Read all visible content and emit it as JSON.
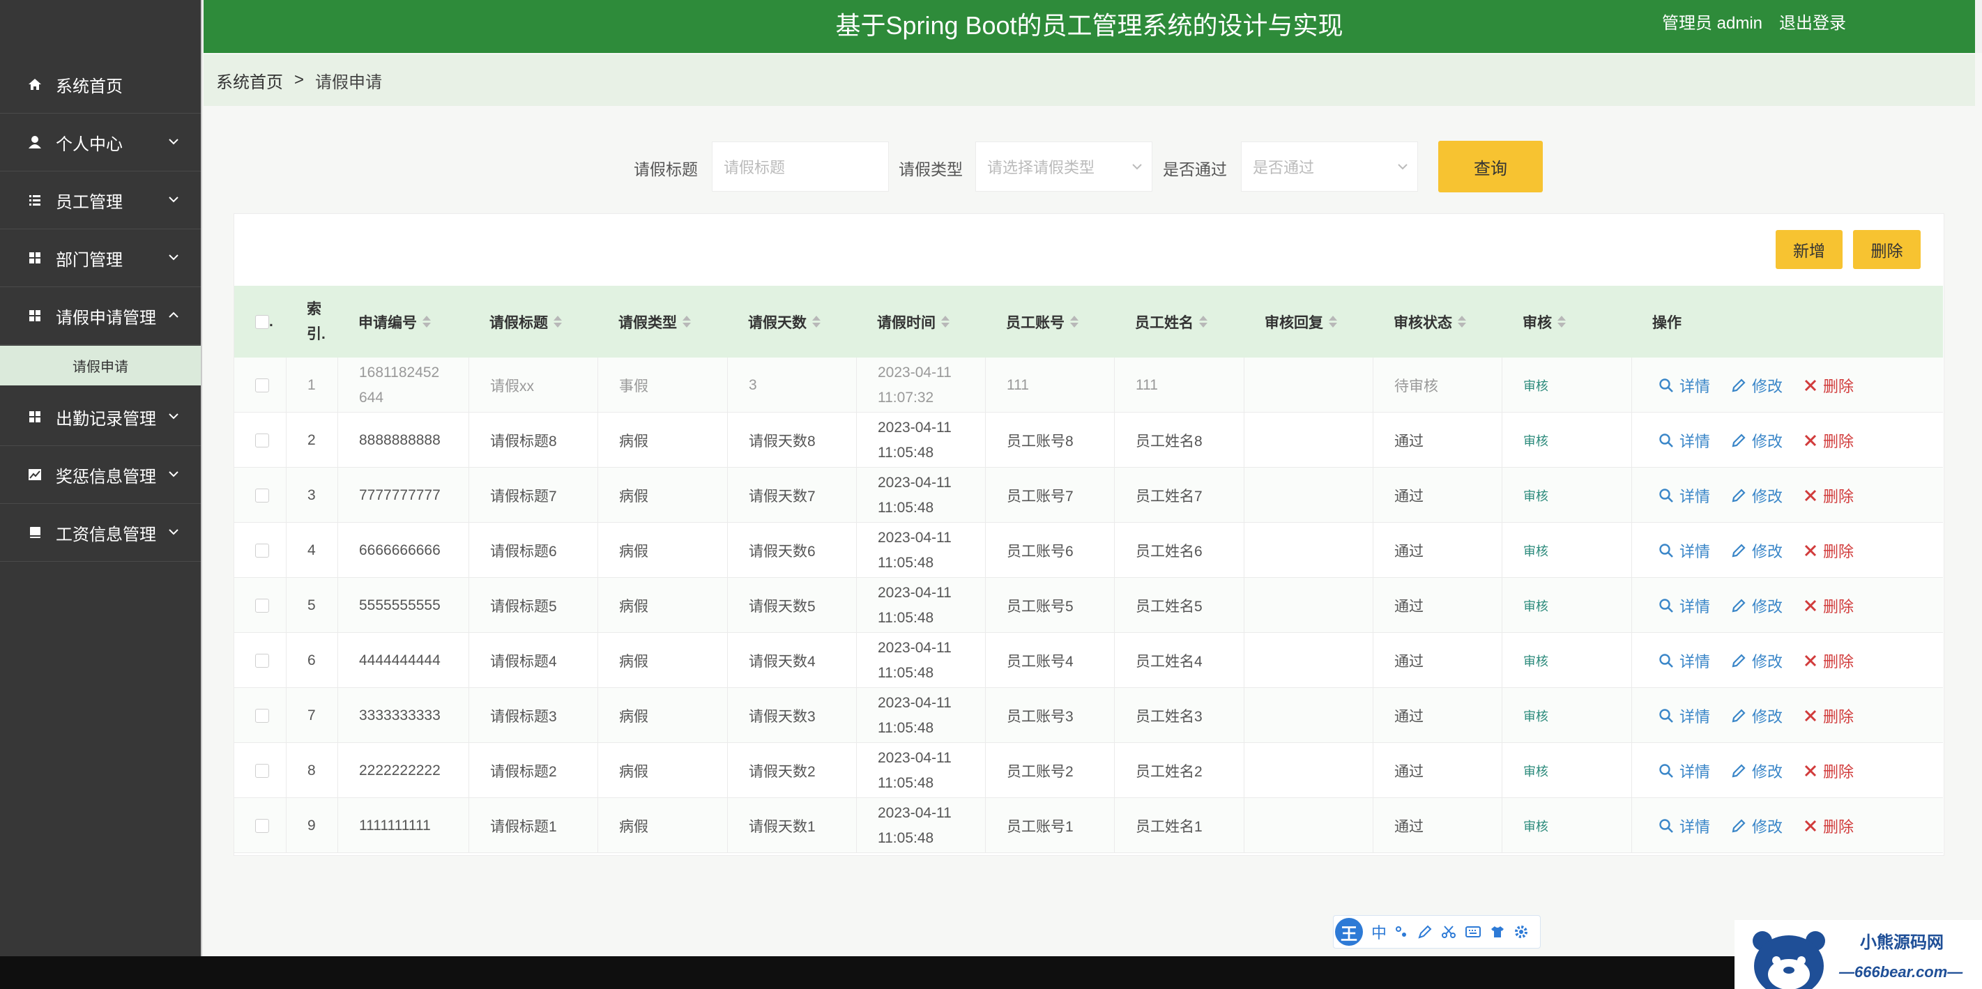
{
  "header": {
    "title": "基于Spring Boot的员工管理系统的设计与实现",
    "admin_label": "管理员 admin",
    "logout_label": "退出登录"
  },
  "sidebar": {
    "items": [
      {
        "label": "系统首页",
        "icon": "home-icon",
        "expandable": false
      },
      {
        "label": "个人中心",
        "icon": "user-icon",
        "expandable": true
      },
      {
        "label": "员工管理",
        "icon": "list-icon",
        "expandable": true
      },
      {
        "label": "部门管理",
        "icon": "grid-icon",
        "expandable": true
      },
      {
        "label": "请假申请管理",
        "icon": "grid-icon",
        "expandable": true,
        "expanded": true
      },
      {
        "label": "出勤记录管理",
        "icon": "grid-icon",
        "expandable": true
      },
      {
        "label": "奖惩信息管理",
        "icon": "chart-icon",
        "expandable": true
      },
      {
        "label": "工资信息管理",
        "icon": "book-icon",
        "expandable": true
      }
    ],
    "sub_item": "请假申请"
  },
  "breadcrumb": {
    "home": "系统首页",
    "separator": ">",
    "current": "请假申请"
  },
  "search": {
    "title_label": "请假标题",
    "title_placeholder": "请假标题",
    "type_label": "请假类型",
    "type_placeholder": "请选择请假类型",
    "pass_label": "是否通过",
    "pass_placeholder": "是否通过",
    "query_label": "查询"
  },
  "toolbar": {
    "add_label": "新增",
    "delete_label": "删除"
  },
  "table": {
    "checkbox_header": ".",
    "index_header": "索\n引.",
    "columns": [
      "申请编号",
      "请假标题",
      "请假类型",
      "请假天数",
      "请假时间",
      "员工账号",
      "员工姓名",
      "审核回复",
      "审核状态",
      "审核",
      "操作"
    ],
    "rows": [
      {
        "index": "1",
        "code": "1681182452\n644",
        "title": "请假xx",
        "type": "事假",
        "days": "3",
        "time": "2023-04-11\n11:07:32",
        "account": "111",
        "name": "111",
        "reply": "",
        "status": "待审核",
        "audit": "审核"
      },
      {
        "index": "2",
        "code": "8888888888",
        "title": "请假标题8",
        "type": "病假",
        "days": "请假天数8",
        "time": "2023-04-11\n11:05:48",
        "account": "员工账号8",
        "name": "员工姓名8",
        "reply": "",
        "status": "通过",
        "audit": "审核"
      },
      {
        "index": "3",
        "code": "7777777777",
        "title": "请假标题7",
        "type": "病假",
        "days": "请假天数7",
        "time": "2023-04-11\n11:05:48",
        "account": "员工账号7",
        "name": "员工姓名7",
        "reply": "",
        "status": "通过",
        "audit": "审核"
      },
      {
        "index": "4",
        "code": "6666666666",
        "title": "请假标题6",
        "type": "病假",
        "days": "请假天数6",
        "time": "2023-04-11\n11:05:48",
        "account": "员工账号6",
        "name": "员工姓名6",
        "reply": "",
        "status": "通过",
        "audit": "审核"
      },
      {
        "index": "5",
        "code": "5555555555",
        "title": "请假标题5",
        "type": "病假",
        "days": "请假天数5",
        "time": "2023-04-11\n11:05:48",
        "account": "员工账号5",
        "name": "员工姓名5",
        "reply": "",
        "status": "通过",
        "audit": "审核"
      },
      {
        "index": "6",
        "code": "4444444444",
        "title": "请假标题4",
        "type": "病假",
        "days": "请假天数4",
        "time": "2023-04-11\n11:05:48",
        "account": "员工账号4",
        "name": "员工姓名4",
        "reply": "",
        "status": "通过",
        "audit": "审核"
      },
      {
        "index": "7",
        "code": "3333333333",
        "title": "请假标题3",
        "type": "病假",
        "days": "请假天数3",
        "time": "2023-04-11\n11:05:48",
        "account": "员工账号3",
        "name": "员工姓名3",
        "reply": "",
        "status": "通过",
        "audit": "审核"
      },
      {
        "index": "8",
        "code": "2222222222",
        "title": "请假标题2",
        "type": "病假",
        "days": "请假天数2",
        "time": "2023-04-11\n11:05:48",
        "account": "员工账号2",
        "name": "员工姓名2",
        "reply": "",
        "status": "通过",
        "audit": "审核"
      },
      {
        "index": "9",
        "code": "1111111111",
        "title": "请假标题1",
        "type": "病假",
        "days": "请假天数1",
        "time": "2023-04-11\n11:05:48",
        "account": "员工账号1",
        "name": "员工姓名1",
        "reply": "",
        "status": "通过",
        "audit": "审核"
      }
    ],
    "actions": {
      "detail": "详情",
      "edit": "修改",
      "delete": "删除"
    }
  },
  "ime": {
    "logo": "王",
    "mode": "中"
  },
  "watermark": {
    "name": "小熊源码网",
    "url": "—666bear.com—"
  },
  "colors": {
    "header_green": "#2e8b3a",
    "sidebar_bg": "#373737",
    "button_yellow": "#f7c331",
    "table_header": "#e1f2e1"
  }
}
